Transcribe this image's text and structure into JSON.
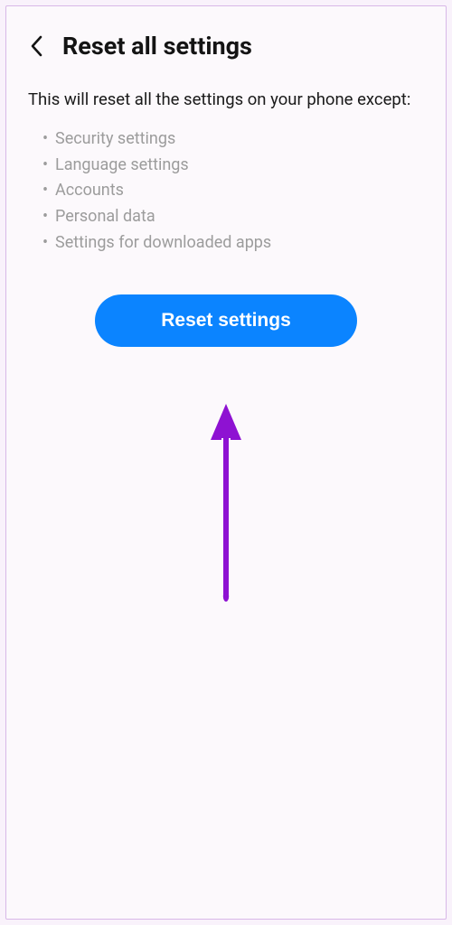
{
  "header": {
    "title": "Reset all settings"
  },
  "description": "This will reset all the settings on your phone except:",
  "exceptions": [
    "Security settings",
    "Language settings",
    "Accounts",
    "Personal data",
    "Settings for downloaded apps"
  ],
  "button": {
    "label": "Reset settings"
  },
  "colors": {
    "accent": "#0b84ff",
    "annotation": "#8e12d2"
  }
}
